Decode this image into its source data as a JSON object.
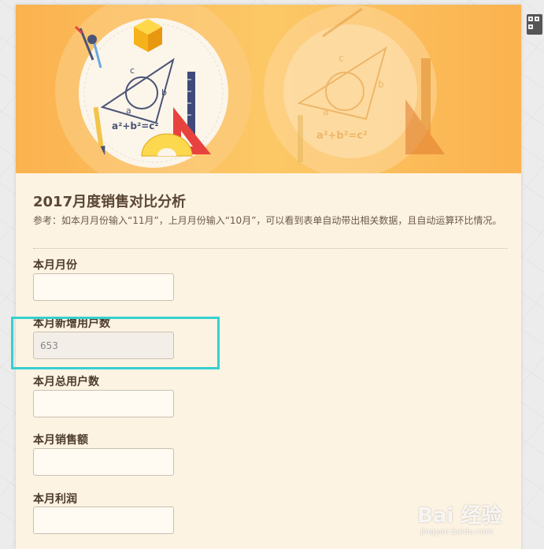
{
  "form": {
    "title": "2017月度销售对比分析",
    "description": "参考：如本月月份输入“11月”，上月月份输入“10月”，可以看到表单自动带出相关数据，且自动运算环比情况。",
    "fields": [
      {
        "label": "本月月份",
        "value": ""
      },
      {
        "label": "本月新增用户数",
        "value": "653"
      },
      {
        "label": "本月总用户数",
        "value": ""
      },
      {
        "label": "本月销售额",
        "value": ""
      },
      {
        "label": "本月利润",
        "value": ""
      }
    ]
  },
  "banner": {
    "formula": "a²+b²=c²",
    "triangle_labels": [
      "a",
      "b",
      "c"
    ]
  },
  "watermark": {
    "brand": "Bai 经验",
    "url": "jingyan.baidu.com"
  },
  "colors": {
    "accent_highlight": "#35d0cf",
    "banner": "#fbb24f",
    "card_bg": "#fdf3e3"
  },
  "icons": [
    "qr-code-icon",
    "compass-icon",
    "ruler-icon",
    "protractor-icon",
    "pencil-icon",
    "cube-icon",
    "set-square-icon"
  ]
}
